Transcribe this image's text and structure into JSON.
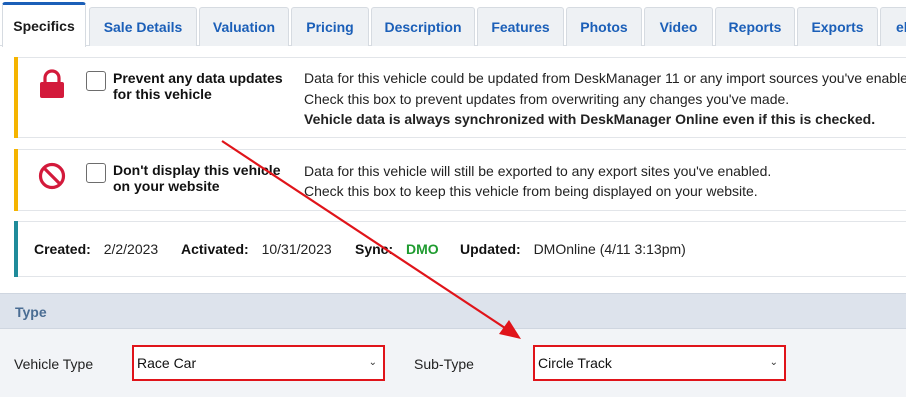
{
  "tabs": [
    {
      "label": "Specifics",
      "active": true
    },
    {
      "label": "Sale Details"
    },
    {
      "label": "Valuation"
    },
    {
      "label": "Pricing"
    },
    {
      "label": "Description"
    },
    {
      "label": "Features"
    },
    {
      "label": "Photos"
    },
    {
      "label": "Video"
    },
    {
      "label": "Reports"
    },
    {
      "label": "Exports"
    },
    {
      "label": "el"
    }
  ],
  "prevent_updates": {
    "icon": "lock-icon",
    "checkbox_label": "Prevent any data updates for this vehicle",
    "line1": "Data for this vehicle could be updated from DeskManager 11 or any import sources you've enable",
    "line2": "Check this box to prevent updates from overwriting any changes you've made.",
    "line3": "Vehicle data is always synchronized with DeskManager Online even if this is checked."
  },
  "no_display": {
    "icon": "ban-icon",
    "checkbox_label": "Don't display this vehicle on your website",
    "line1": "Data for this vehicle will still be exported to any export sites you've enabled.",
    "line2": "Check this box to keep this vehicle from being displayed on your website."
  },
  "info": {
    "created_label": "Created:",
    "created_value": "2/2/2023",
    "activated_label": "Activated:",
    "activated_value": "10/31/2023",
    "sync_label": "Sync:",
    "sync_value": "DMO",
    "updated_label": "Updated:",
    "updated_value": "DMOnline (4/11 3:13pm)"
  },
  "type_section": {
    "title": "Type",
    "vehicle_type_label": "Vehicle Type",
    "vehicle_type_value": "Race Car",
    "sub_type_label": "Sub-Type",
    "sub_type_value": "Circle Track"
  },
  "colors": {
    "accent_blue": "#1b5fb8",
    "warning_yellow": "#f5b400",
    "info_teal": "#1f8b9a",
    "annotation_red": "#e0141a",
    "sync_green": "#1e9b2f"
  }
}
